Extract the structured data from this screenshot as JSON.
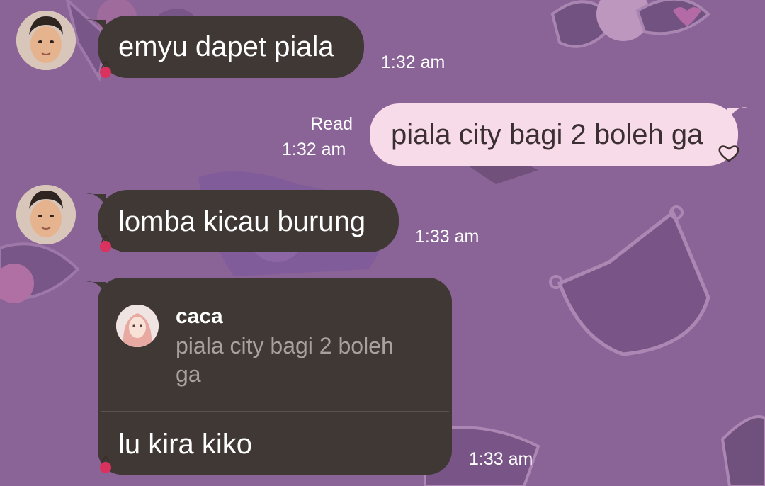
{
  "messages": [
    {
      "direction": "incoming",
      "text": "emyu dapet piala",
      "time": "1:32 am"
    },
    {
      "direction": "outgoing",
      "status": "Read",
      "text": "piala city bagi 2 boleh ga",
      "time": "1:32 am"
    },
    {
      "direction": "incoming",
      "text": "lomba kicau burung",
      "time": "1:33 am"
    },
    {
      "direction": "incoming",
      "reply_to": {
        "name": "caca",
        "text": "piala city bagi 2 boleh ga"
      },
      "text": "lu kira kiko",
      "time": "1:33 am"
    }
  ],
  "colors": {
    "background": "#8a6496",
    "incoming_bubble": "#3f3835",
    "outgoing_bubble": "#f8dbe8"
  }
}
